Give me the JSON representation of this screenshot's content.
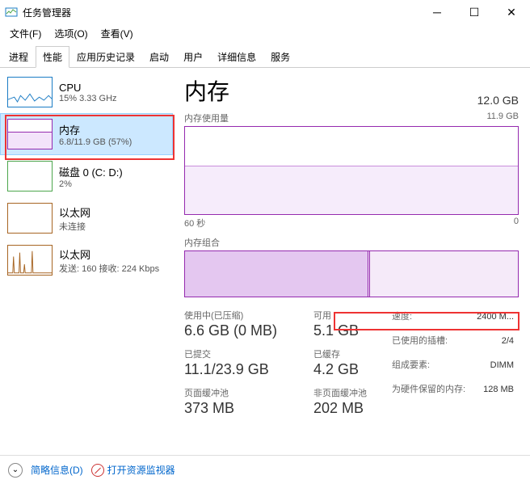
{
  "window": {
    "title": "任务管理器"
  },
  "menu": {
    "file": "文件(F)",
    "options": "选项(O)",
    "view": "查看(V)"
  },
  "tabs": {
    "processes": "进程",
    "performance": "性能",
    "history": "应用历史记录",
    "startup": "启动",
    "users": "用户",
    "details": "详细信息",
    "services": "服务"
  },
  "sidebar": {
    "cpu": {
      "title": "CPU",
      "sub": "15% 3.33 GHz"
    },
    "memory": {
      "title": "内存",
      "sub": "6.8/11.9 GB (57%)"
    },
    "disk": {
      "title": "磁盘 0 (C: D:)",
      "sub": "2%"
    },
    "eth0": {
      "title": "以太网",
      "sub": "未连接"
    },
    "eth1": {
      "title": "以太网",
      "sub": "发送: 160 接收: 224 Kbps"
    }
  },
  "main": {
    "title": "内存",
    "total": "12.0 GB",
    "usage_label": "内存使用量",
    "usage_max": "11.9 GB",
    "x_start": "60 秒",
    "x_end": "0",
    "comp_label": "内存组合",
    "stats": {
      "in_use_label": "使用中(已压缩)",
      "in_use": "6.6 GB (0 MB)",
      "avail_label": "可用",
      "avail": "5.1 GB",
      "committed_label": "已提交",
      "committed": "11.1/23.9 GB",
      "cached_label": "已缓存",
      "cached": "4.2 GB",
      "paged_label": "页面缓冲池",
      "paged": "373 MB",
      "nonpaged_label": "非页面缓冲池",
      "nonpaged": "202 MB"
    },
    "info": {
      "speed_k": "速度:",
      "speed_v": "2400 M...",
      "slots_k": "已使用的插槽:",
      "slots_v": "2/4",
      "form_k": "组成要素:",
      "form_v": "DIMM",
      "reserved_k": "为硬件保留的内存:",
      "reserved_v": "128 MB"
    }
  },
  "footer": {
    "fewer": "简略信息(D)",
    "resmon": "打开资源监视器"
  }
}
